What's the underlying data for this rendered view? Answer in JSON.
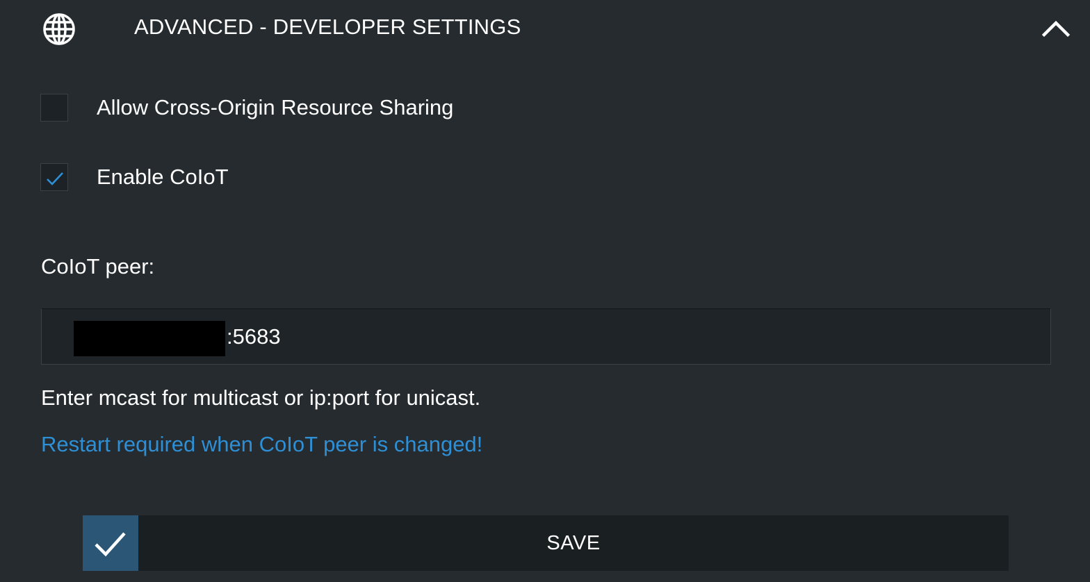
{
  "header": {
    "icon": "globe-icon",
    "title": "ADVANCED - DEVELOPER SETTINGS",
    "collapse_icon": "chevron-up-icon"
  },
  "options": {
    "cors": {
      "label": "Allow Cross-Origin Resource Sharing",
      "checked": false
    },
    "coiot": {
      "label": "Enable CoIoT",
      "checked": true
    }
  },
  "coiot_peer": {
    "label": "CoIoT peer:",
    "value": ":5683",
    "hint": "Enter mcast for multicast or ip:port for unicast.",
    "warning": "Restart required when CoIoT peer is changed!"
  },
  "save": {
    "icon": "checkmark-icon",
    "label": "SAVE"
  },
  "colors": {
    "background": "#252b2f",
    "accent": "#2f8fd5",
    "save_icon_bg": "#2b5675"
  }
}
